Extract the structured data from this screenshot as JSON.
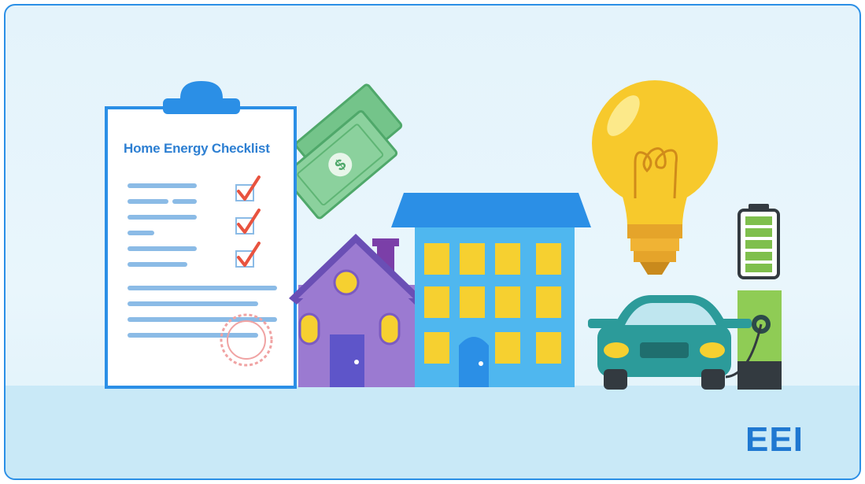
{
  "checklist": {
    "title": "Home Energy Checklist"
  },
  "brand": {
    "logo_text": "EEI"
  },
  "colors": {
    "frame_border": "#2b8fe6",
    "background": "#e4f3fb",
    "floor": "#c9e9f7",
    "brand_blue": "#1f78d1",
    "checkmark_red": "#e8533f",
    "money_green": "#6cbf84",
    "house_purple": "#9b7ad1",
    "building_blue": "#4fb7ef",
    "window_yellow": "#f6d030",
    "bulb_yellow": "#f7c92c",
    "car_teal": "#2c9b9a",
    "charger_green": "#7fbf4d"
  },
  "icons": [
    "clipboard-icon",
    "checkmark-icon",
    "stamp-icon",
    "dollar-bill-icon",
    "house-icon",
    "apartment-building-icon",
    "light-bulb-icon",
    "battery-icon",
    "electric-car-icon",
    "ev-charger-icon"
  ]
}
